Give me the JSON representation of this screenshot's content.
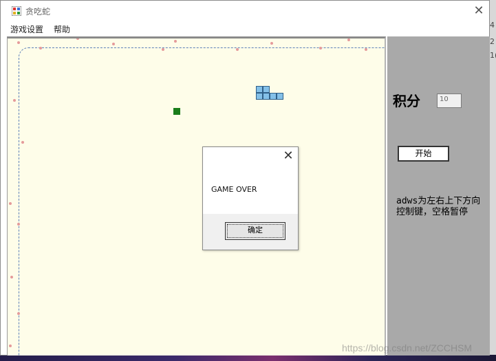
{
  "window": {
    "title": "贪吃蛇",
    "close_glyph": "✕"
  },
  "menu": {
    "items": [
      {
        "label": "游戏设置"
      },
      {
        "label": "帮助"
      }
    ]
  },
  "board": {
    "background": "#fefde9",
    "food_color": "#1a7d1a",
    "snake_color": "#84c0e8"
  },
  "panel": {
    "background": "#a9a9a9",
    "score_label": "积分",
    "score_value": "10",
    "start_button": "开始",
    "hint": "adws为左右上下方向控制键，空格暂停"
  },
  "dialog": {
    "close_glyph": "✕",
    "message": "GAME OVER",
    "ok_button": "确定"
  },
  "desktop": {
    "edge_texts": [
      "4",
      "2",
      "1("
    ]
  },
  "watermark": "https://blog.csdn.net/ZCCHSM"
}
